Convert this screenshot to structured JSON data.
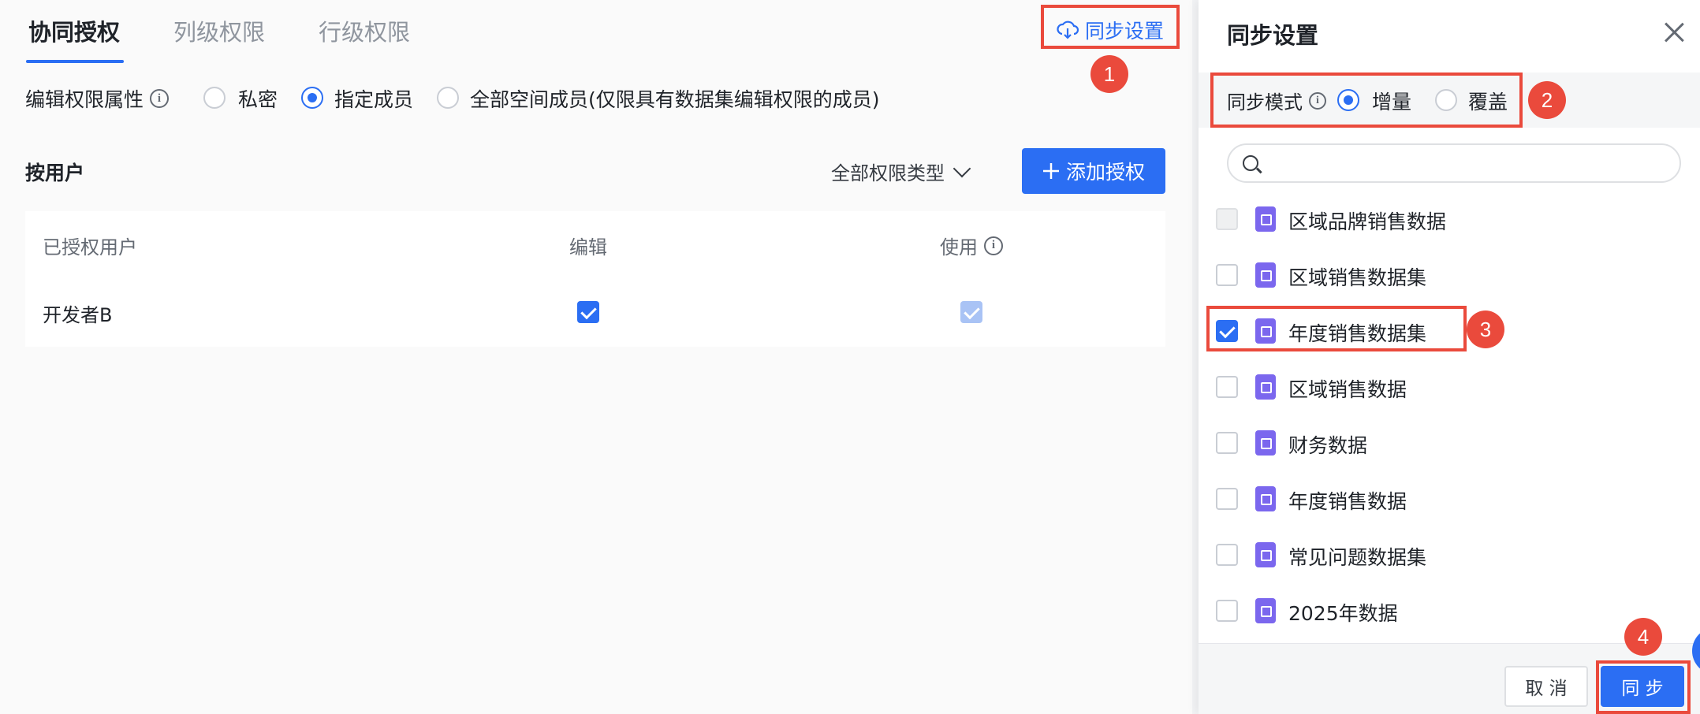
{
  "tabs": [
    {
      "label": "协同授权",
      "active": true
    },
    {
      "label": "列级权限",
      "active": false
    },
    {
      "label": "行级权限",
      "active": false
    }
  ],
  "sync_settings_link": "同步设置",
  "edit_property": {
    "label": "编辑权限属性",
    "options": [
      {
        "label": "私密",
        "selected": false
      },
      {
        "label": "指定成员",
        "selected": true
      },
      {
        "label": "全部空间成员(仅限具有数据集编辑权限的成员)",
        "selected": false
      }
    ]
  },
  "by_user_label": "按用户",
  "permission_filter": "全部权限类型",
  "add_auth_button": "添加授权",
  "table": {
    "headers": [
      "已授权用户",
      "编辑",
      "使用"
    ],
    "rows": [
      {
        "user": "开发者B",
        "edit": true,
        "use": true
      }
    ]
  },
  "drawer": {
    "title": "同步设置",
    "mode_label": "同步模式",
    "modes": [
      {
        "label": "增量",
        "selected": true
      },
      {
        "label": "覆盖",
        "selected": false
      }
    ],
    "search_placeholder": "",
    "datasets": [
      {
        "label": "区域品牌销售数据",
        "state": "disabled"
      },
      {
        "label": "区域销售数据集",
        "state": "unchecked"
      },
      {
        "label": "年度销售数据集",
        "state": "checked"
      },
      {
        "label": "区域销售数据",
        "state": "unchecked"
      },
      {
        "label": "财务数据",
        "state": "unchecked"
      },
      {
        "label": "年度销售数据",
        "state": "unchecked"
      },
      {
        "label": "常见问题数据集",
        "state": "unchecked"
      },
      {
        "label": "2025年数据",
        "state": "unchecked"
      }
    ],
    "cancel_button": "取 消",
    "sync_button": "同 步"
  },
  "step_badges": [
    "1",
    "2",
    "3",
    "4"
  ],
  "colors": {
    "accent": "#2b6ef3",
    "annotation": "#ea4a3c",
    "dataset_icon": "#7b67ee"
  }
}
